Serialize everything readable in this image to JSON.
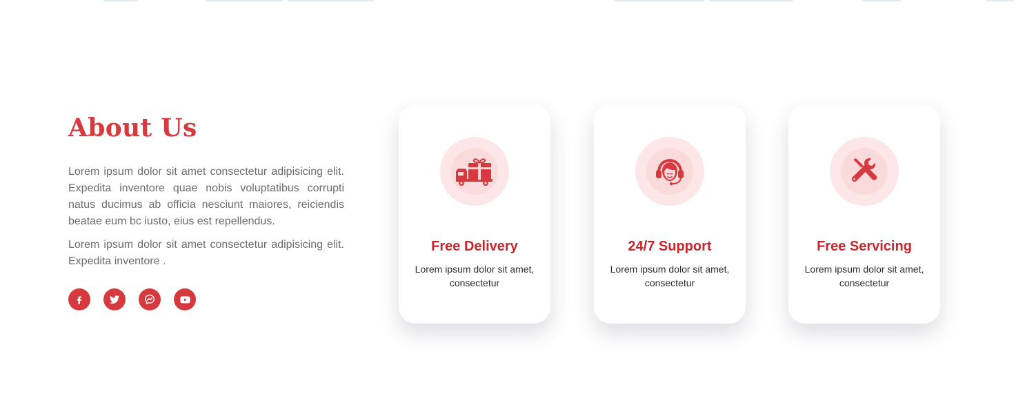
{
  "colors": {
    "accent": "#d63a3f",
    "card_title": "#c4262c",
    "icon_bg": "#fde6e7",
    "body_text": "#6b6b6b"
  },
  "about": {
    "title": "About Us",
    "paragraph_1": "Lorem ipsum dolor sit amet consectetur adipisicing elit. Expedita inventore quae nobis voluptatibus corrupti natus ducimus ab officia nesciunt maiores, reiciendis beatae eum bc iusto, eius est repellendus.",
    "paragraph_2": "Lorem ipsum dolor sit amet consectetur adipisicing elit. Expedita inventore ."
  },
  "socials": [
    {
      "icon": "facebook-icon"
    },
    {
      "icon": "twitter-icon"
    },
    {
      "icon": "messenger-icon"
    },
    {
      "icon": "youtube-icon"
    }
  ],
  "cards": [
    {
      "icon": "delivery-truck-gift-icon",
      "title": "Free Delivery",
      "text": "Lorem ipsum dolor sit amet, consectetur"
    },
    {
      "icon": "headset-support-icon",
      "title": "24/7 Support",
      "text": "Lorem ipsum dolor sit amet, consectetur"
    },
    {
      "icon": "wrench-screwdriver-icon",
      "title": "Free Servicing",
      "text": "Lorem ipsum dolor sit amet, consectetur"
    }
  ]
}
